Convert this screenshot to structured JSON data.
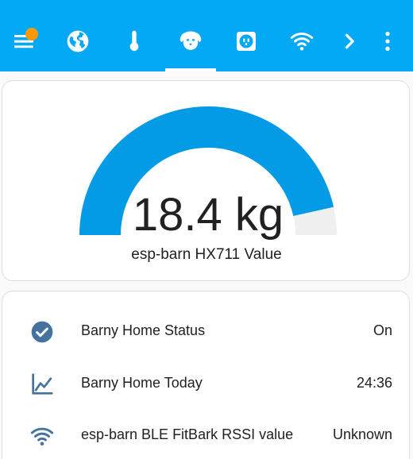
{
  "colors": {
    "header": "#03a9f4",
    "gauge_fill": "#039be5",
    "gauge_track": "#f0f0f0",
    "icon": "#44739e",
    "badge": "#ff9800"
  },
  "toolbar": {
    "menu_icon": "menu-icon",
    "tabs": [
      {
        "icon": "globe-icon"
      },
      {
        "icon": "thermometer-icon"
      },
      {
        "icon": "dog-icon",
        "active": true
      },
      {
        "icon": "power-socket-icon"
      },
      {
        "icon": "wifi-icon"
      }
    ],
    "more_tabs_icon": "chevron-right-icon",
    "overflow_icon": "dots-vertical-icon"
  },
  "gauge": {
    "value": "18.4 kg",
    "level": 0.93,
    "name": "esp-barn HX711 Value"
  },
  "entities": [
    {
      "icon": "check-circle-icon",
      "name": "Barny Home Status",
      "state": "On"
    },
    {
      "icon": "chart-line-icon",
      "name": "Barny Home Today",
      "state": "24:36"
    },
    {
      "icon": "wifi-icon",
      "name": "esp-barn BLE FitBark RSSI value",
      "state": "Unknown"
    }
  ]
}
